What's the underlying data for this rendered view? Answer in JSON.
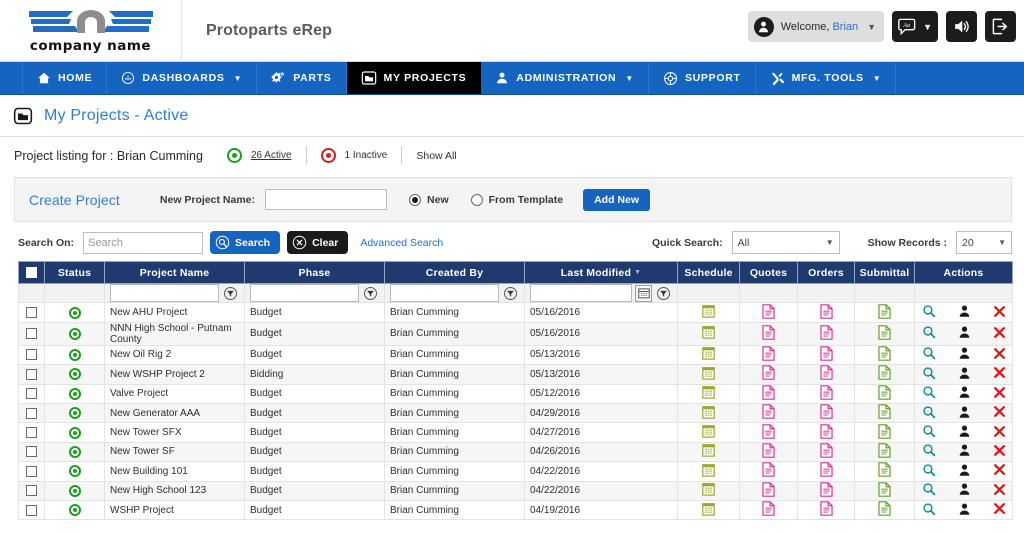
{
  "header": {
    "logo_text": "company name",
    "app_title": "Protoparts eRep",
    "welcome_prefix": "Welcome,",
    "welcome_name": "Brian",
    "translate_icon": "translate-icon",
    "sound_icon": "sound-icon",
    "logout_icon": "logout-icon"
  },
  "nav": {
    "items": [
      {
        "label": "HOME",
        "icon": "home-icon",
        "active": false,
        "caret": false
      },
      {
        "label": "DASHBOARDS",
        "icon": "dashboard-gauge-icon",
        "active": false,
        "caret": true
      },
      {
        "label": "PARTS",
        "icon": "gear-icon",
        "active": false,
        "caret": false
      },
      {
        "label": "MY PROJECTS",
        "icon": "folder-icon",
        "active": true,
        "caret": false
      },
      {
        "label": "ADMINISTRATION",
        "icon": "user-icon",
        "active": false,
        "caret": true
      },
      {
        "label": "SUPPORT",
        "icon": "lifebuoy-icon",
        "active": false,
        "caret": false
      },
      {
        "label": "MFG. TOOLS",
        "icon": "tools-icon",
        "active": false,
        "caret": true
      }
    ]
  },
  "page": {
    "title": "My Projects - Active",
    "title_icon": "folder-icon",
    "title_color": "#2f7fd0"
  },
  "listing": {
    "label": "Project listing for : Brian Cumming",
    "active_count": "26 Active",
    "inactive_count": "1 Inactive",
    "show_all": "Show All",
    "active_color": "#1e9e1e",
    "inactive_color": "#d81b1b"
  },
  "create_project": {
    "title": "Create Project",
    "name_label": "New Project Name:",
    "name_value": "",
    "name_placeholder": "",
    "radio_new": "New",
    "radio_template": "From Template",
    "radio_selected": "New",
    "add_button": "Add New",
    "button_color": "#1565c0"
  },
  "search": {
    "label": "Search On:",
    "input_value": "",
    "input_placeholder": "Search",
    "search_button": "Search",
    "clear_button": "Clear",
    "advanced_link": "Advanced Search",
    "quick_search_label": "Quick Search:",
    "quick_search_value": "All",
    "show_records_label": "Show Records :",
    "show_records_value": "20"
  },
  "table": {
    "columns": [
      {
        "label": "",
        "key": "check",
        "filter": "none"
      },
      {
        "label": "Status",
        "key": "status",
        "filter": "none"
      },
      {
        "label": "Project Name",
        "key": "project_name",
        "filter": "text"
      },
      {
        "label": "Phase",
        "key": "phase",
        "filter": "text"
      },
      {
        "label": "Created By",
        "key": "created_by",
        "filter": "text"
      },
      {
        "label": "Last Modified",
        "key": "last_modified",
        "filter": "date",
        "sorted": true
      },
      {
        "label": "Schedule",
        "key": "schedule",
        "filter": "none"
      },
      {
        "label": "Quotes",
        "key": "quotes",
        "filter": "none"
      },
      {
        "label": "Orders",
        "key": "orders",
        "filter": "none"
      },
      {
        "label": "Submittal",
        "key": "submittal",
        "filter": "none"
      },
      {
        "label": "Actions",
        "key": "actions",
        "filter": "none"
      }
    ],
    "filters": {
      "project_name": "",
      "phase": "",
      "created_by": "",
      "last_modified": ""
    },
    "row_icons": {
      "schedule": "calendar-icon",
      "quotes": "document-icon",
      "orders": "document-icon",
      "submittal": "document-icon",
      "view": "magnifier-icon",
      "contact": "person-icon",
      "delete": "delete-x-icon"
    },
    "icon_colors": {
      "schedule": "#9aa832",
      "quotes": "#d6309a",
      "orders": "#d6309a",
      "submittal": "#5f9e22",
      "view": "#0b8c93",
      "contact": "#1a1a1a",
      "delete": "#d81b1b",
      "status": "#1e9e1e"
    },
    "rows": [
      {
        "project_name": "New AHU Project",
        "phase": "Budget",
        "created_by": "Brian Cumming",
        "last_modified": "05/16/2016"
      },
      {
        "project_name": "NNN High School - Putnam County",
        "phase": "Budget",
        "created_by": "Brian Cumming",
        "last_modified": "05/16/2016"
      },
      {
        "project_name": "New Oil Rig 2",
        "phase": "Budget",
        "created_by": "Brian Cumming",
        "last_modified": "05/13/2016"
      },
      {
        "project_name": "New WSHP Project 2",
        "phase": "Bidding",
        "created_by": "Brian Cumming",
        "last_modified": "05/13/2016"
      },
      {
        "project_name": "Valve Project",
        "phase": "Budget",
        "created_by": "Brian Cumming",
        "last_modified": "05/12/2016"
      },
      {
        "project_name": "New Generator AAA",
        "phase": "Budget",
        "created_by": "Brian Cumming",
        "last_modified": "04/29/2016"
      },
      {
        "project_name": "New Tower SFX",
        "phase": "Budget",
        "created_by": "Brian Cumming",
        "last_modified": "04/27/2016"
      },
      {
        "project_name": "New Tower SF",
        "phase": "Budget",
        "created_by": "Brian Cumming",
        "last_modified": "04/26/2016"
      },
      {
        "project_name": "New Building 101",
        "phase": "Budget",
        "created_by": "Brian Cumming",
        "last_modified": "04/22/2016"
      },
      {
        "project_name": "New High School 123",
        "phase": "Budget",
        "created_by": "Brian Cumming",
        "last_modified": "04/22/2016"
      },
      {
        "project_name": "WSHP Project",
        "phase": "Budget",
        "created_by": "Brian Cumming",
        "last_modified": "04/19/2016"
      }
    ]
  }
}
